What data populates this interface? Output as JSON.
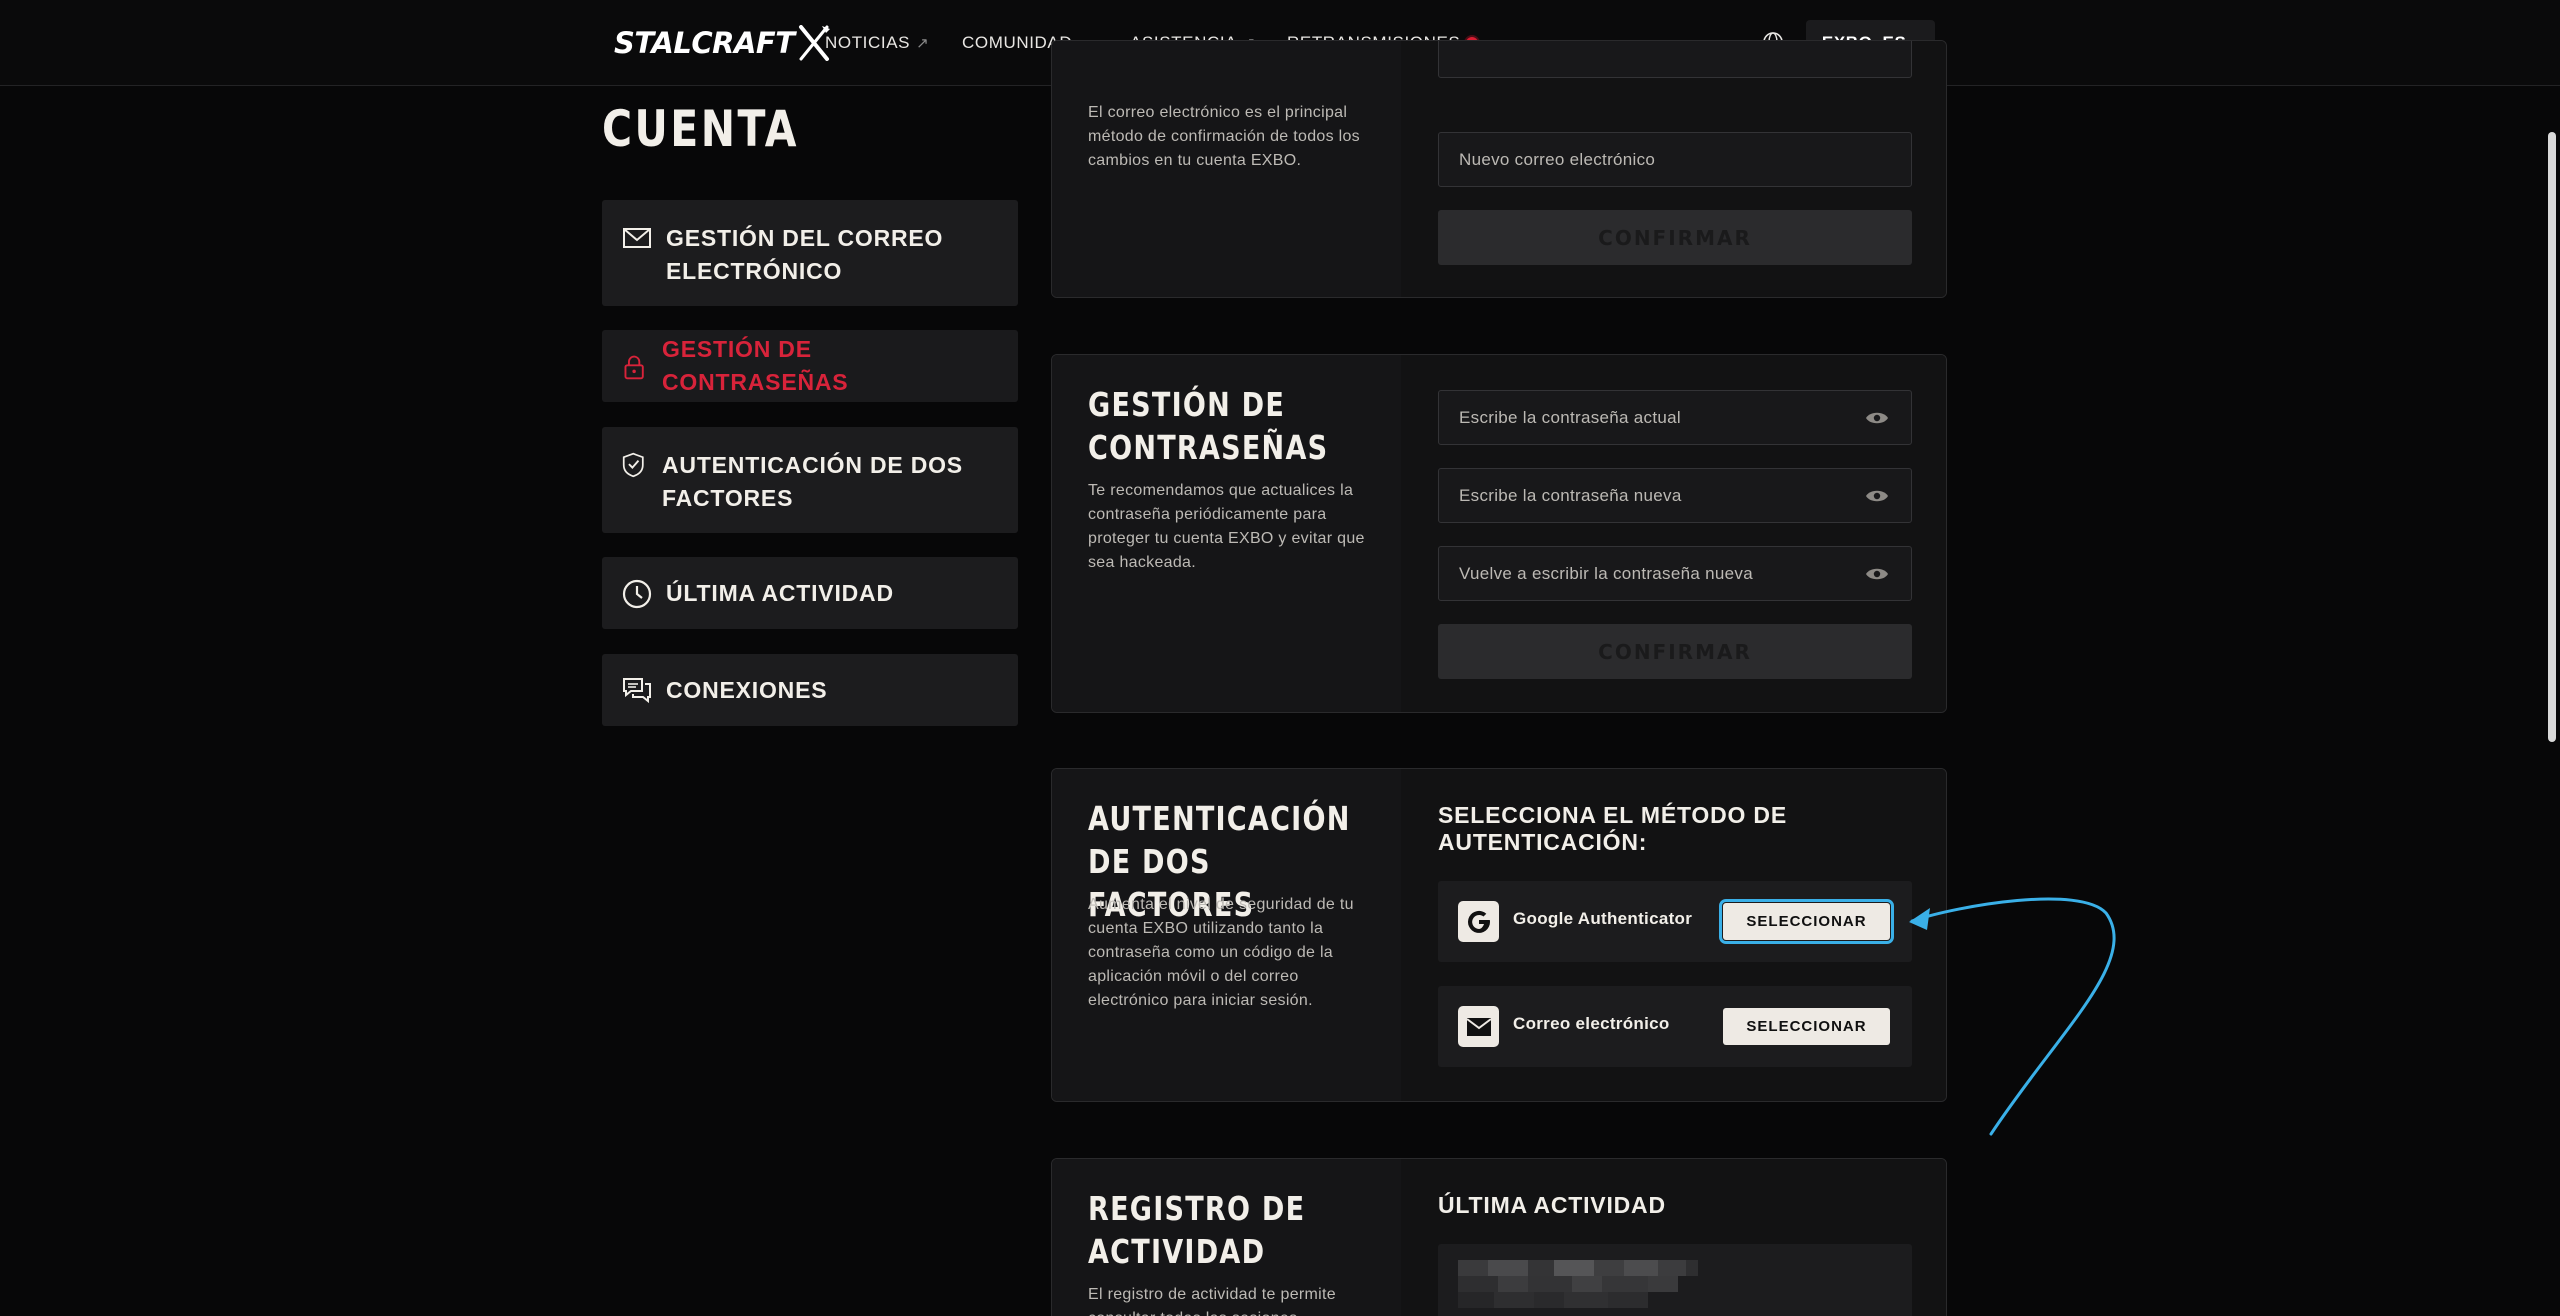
{
  "header": {
    "logo": "STALCRAFT",
    "nav": [
      {
        "label": "NOTICIAS",
        "suffix": "↗"
      },
      {
        "label": "COMUNIDAD",
        "suffix": "▾"
      },
      {
        "label": "ASISTENCIA",
        "suffix": "↗"
      },
      {
        "label": "RETRANSMISIONES",
        "suffix": ""
      }
    ],
    "user": "EXBO_ES",
    "user_caret": "▾"
  },
  "sidebar": {
    "title": "CUENTA",
    "items": [
      {
        "label": "GESTIÓN DEL CORREO ELECTRÓNICO",
        "icon": "mail-icon"
      },
      {
        "label": "GESTIÓN DE CONTRASEÑAS",
        "icon": "lock-icon",
        "active": true
      },
      {
        "label": "AUTENTICACIÓN DE DOS FACTORES",
        "icon": "shield-check-icon"
      },
      {
        "label": "ÚLTIMA ACTIVIDAD",
        "icon": "clock-icon"
      },
      {
        "label": "CONEXIONES",
        "icon": "chat-icon"
      }
    ]
  },
  "email_card": {
    "description": "El correo electrónico es el principal método de confirmación de todos los cambios en tu cuenta EXBO.",
    "new_email_placeholder": "Nuevo correo electrónico",
    "confirm": "CONFIRMAR"
  },
  "password_card": {
    "title": "GESTIÓN DE CONTRASEÑAS",
    "description": "Te recomendamos que actualices la contraseña periódicamente para proteger tu cuenta EXBO y evitar que sea hackeada.",
    "current_placeholder": "Escribe la contraseña actual",
    "new_placeholder": "Escribe la contraseña nueva",
    "repeat_placeholder": "Vuelve a escribir la contraseña nueva",
    "confirm": "CONFIRMAR"
  },
  "twofa_card": {
    "title": "AUTENTICACIÓN DE DOS FACTORES",
    "description": "Aumenta el nivel de seguridad de tu cuenta EXBO utilizando tanto la contraseña como un código de la aplicación móvil o del correo electrónico para iniciar sesión.",
    "select_heading": "SELECCIONA EL MÉTODO DE AUTENTICACIÓN:",
    "methods": [
      {
        "label": "Google Authenticator",
        "button": "SELECCIONAR",
        "icon": "google-icon"
      },
      {
        "label": "Correo electrónico",
        "button": "SELECCIONAR",
        "icon": "envelope-icon"
      }
    ]
  },
  "activity_card": {
    "title": "REGISTRO DE ACTIVIDAD",
    "description": "El registro de actividad te permite consultar todas las sesiones",
    "heading": "ÚLTIMA ACTIVIDAD"
  },
  "colors": {
    "accent_red": "#d8233a",
    "highlight_blue": "#3ab0e8"
  }
}
